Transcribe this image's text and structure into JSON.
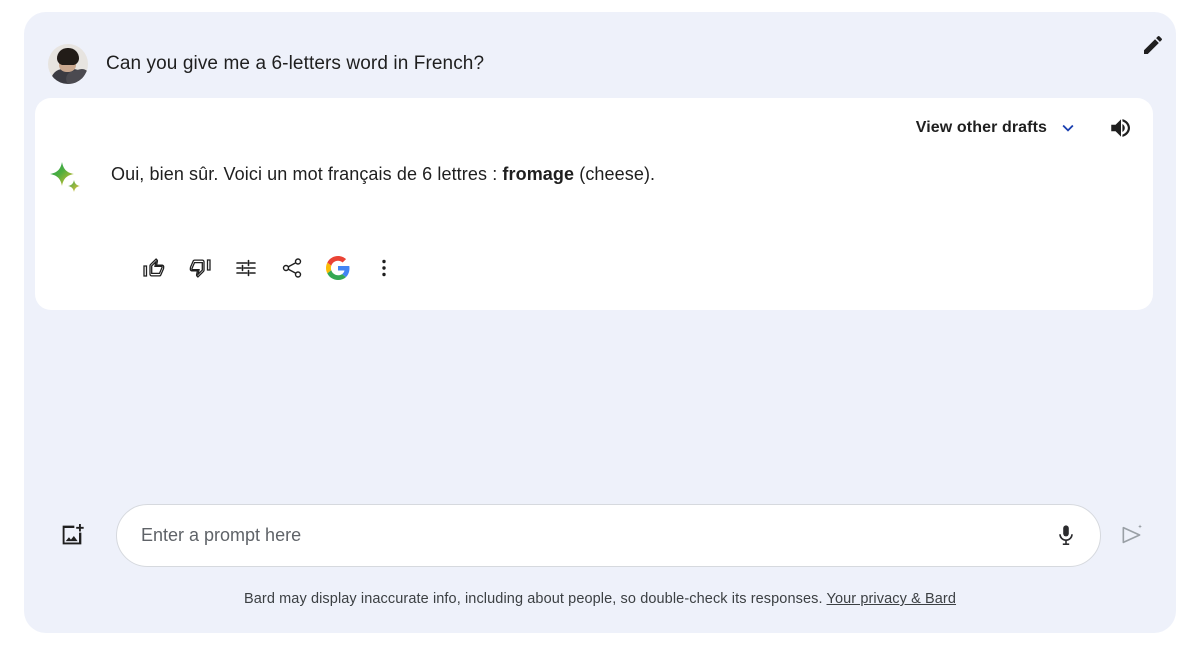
{
  "app": {
    "name": "Bard",
    "panel_bg": "#eef1fa",
    "card_bg": "#ffffff",
    "accent_blue": "#1a73e8"
  },
  "conversation": {
    "user": {
      "avatar_name": "user-avatar",
      "prompt": "Can you give me a 6-letters word in French?",
      "edit_icon": "pencil-icon"
    },
    "response": {
      "drafts_label": "View other drafts",
      "drafts_chevron_icon": "chevron-down-icon",
      "speaker_icon": "volume-up-icon",
      "bard_icon": "bard-sparkle-icon",
      "text_before": "Oui, bien sûr. Voici un mot français de 6 lettres : ",
      "text_bold": "fromage",
      "text_after": " (cheese).",
      "actions": [
        {
          "name": "thumb-up-icon",
          "label": "Good response"
        },
        {
          "name": "thumb-down-icon",
          "label": "Bad response"
        },
        {
          "name": "tune-icon",
          "label": "Modify response"
        },
        {
          "name": "share-icon",
          "label": "Share & export"
        },
        {
          "name": "google-g-icon",
          "label": "Google it"
        },
        {
          "name": "more-vert-icon",
          "label": "More"
        }
      ]
    }
  },
  "composer": {
    "image_icon": "add-image-icon",
    "placeholder": "Enter a prompt here",
    "value": "",
    "mic_icon": "microphone-icon",
    "send_icon": "send-sparkle-icon"
  },
  "footer": {
    "disclaimer": "Bard may display inaccurate info, including about people, so double-check its responses.",
    "link": "Your privacy & Bard"
  }
}
